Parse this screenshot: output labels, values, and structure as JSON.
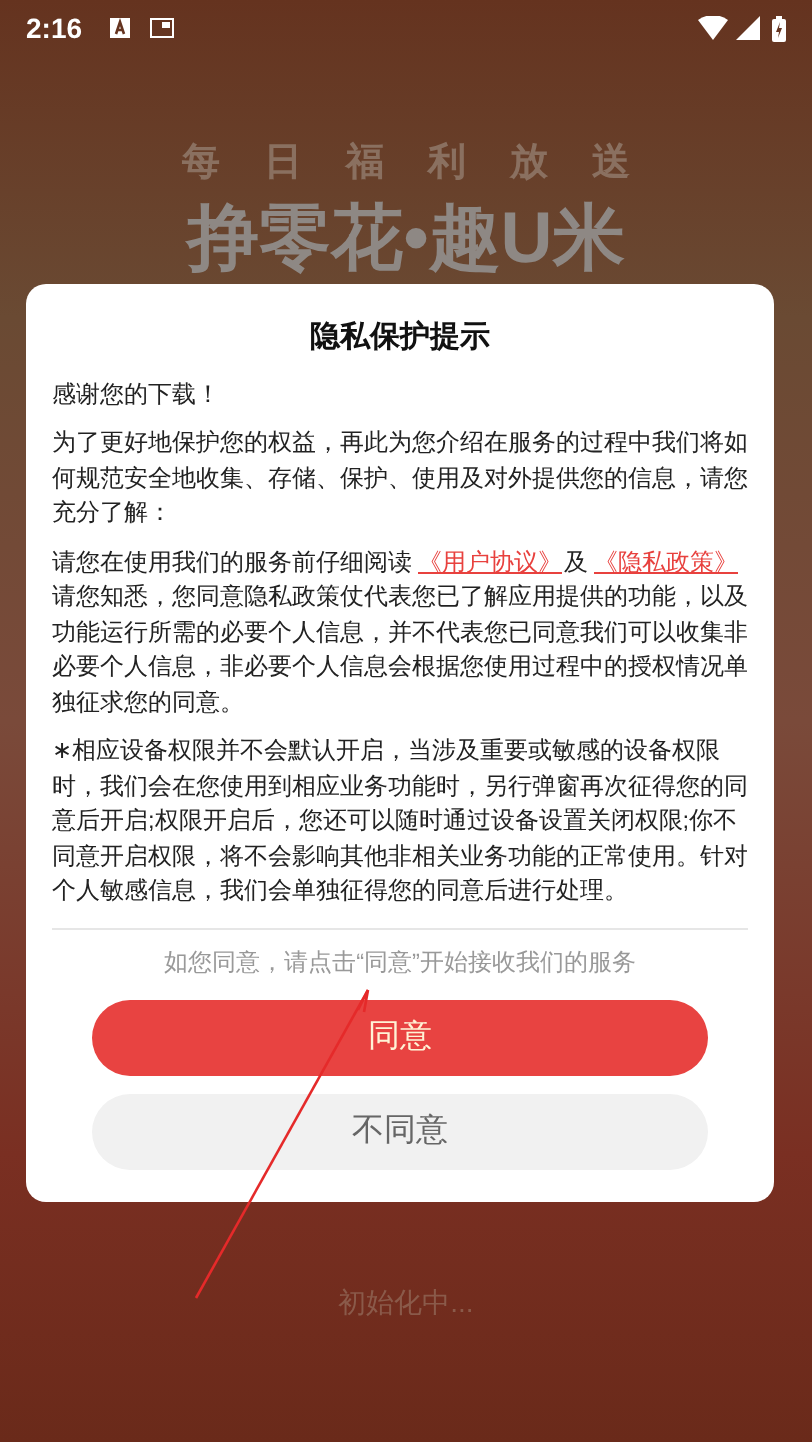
{
  "status_bar": {
    "time": "2:16"
  },
  "background": {
    "tagline": "每日福利放送",
    "headline": "挣零花•趣U米",
    "loading": "初始化中..."
  },
  "dialog": {
    "title": "隐私保护提示",
    "paragraphs": [
      {
        "parts": [
          {
            "kind": "text",
            "text": "感谢您的下载！"
          }
        ]
      },
      {
        "parts": [
          {
            "kind": "text",
            "text": "为了更好地保护您的权益，再此为您介绍在服务的过程中我们将如何规范安全地收集、存储、保护、使用及对外提供您的信息，请您充分了解："
          }
        ]
      },
      {
        "parts": [
          {
            "kind": "text",
            "text": "请您在使用我们的服务前仔细阅读"
          },
          {
            "kind": "link",
            "text": "《用户协议》"
          },
          {
            "kind": "text",
            "text": "及"
          },
          {
            "kind": "link",
            "text": "《隐私政策》"
          },
          {
            "kind": "text",
            "text": "请您知悉，您同意隐私政策仗代表您已了解应用提供的功能，以及功能运行所需的必要个人信息，并不代表您已同意我们可以收集非必要个人信息，非必要个人信息会根据您使用过程中的授权情况单独征求您的同意。"
          }
        ]
      },
      {
        "parts": [
          {
            "kind": "text",
            "text": "∗相应设备权限并不会默认开启，当涉及重要或敏感的设备权限时，我们会在您使用到相应业务功能时，另行弹窗再次征得您的同意后开启;权限开启后，您还可以随时通过设备设置关闭权限;你不同意开启权限，将不会影响其他非相关业务功能的正常使用。针对个人敏感信息，我们会单独征得您的同意后进行处理。"
          }
        ]
      }
    ],
    "hint": "如您同意，请点击“同意”开始接收我们的服务",
    "buttons": [
      {
        "kind": "primary",
        "label": "同意"
      },
      {
        "kind": "secondary",
        "label": "不同意"
      }
    ]
  }
}
